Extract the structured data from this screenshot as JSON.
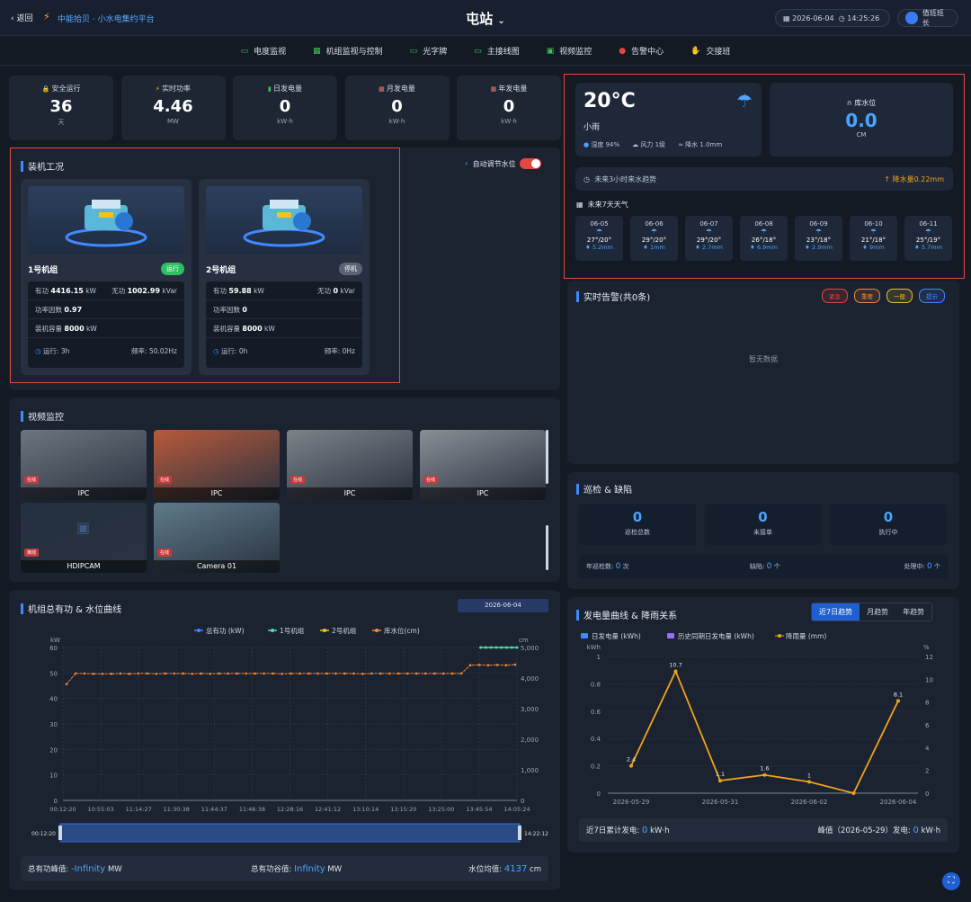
{
  "header": {
    "back": "返回",
    "brand": "中能拾贝 · 小水电集约平台",
    "title": "屯站",
    "date": "2026-06-04",
    "time": "14:25:26",
    "user": "值班班长"
  },
  "nav": [
    {
      "label": "电度监视",
      "icon": "monitor-icon"
    },
    {
      "label": "机组监视与控制",
      "icon": "control-icon"
    },
    {
      "label": "光字牌",
      "icon": "monitor-icon"
    },
    {
      "label": "主接线图",
      "icon": "monitor-icon"
    },
    {
      "label": "视频监控",
      "icon": "video-icon"
    },
    {
      "label": "告警中心",
      "icon": "alert-icon"
    },
    {
      "label": "交接班",
      "icon": "hand-icon"
    }
  ],
  "stats": [
    {
      "label": "安全运行",
      "value": "36",
      "unit": "天",
      "icon": "lock-icon"
    },
    {
      "label": "实时功率",
      "value": "4.46",
      "unit": "MW",
      "icon": "bolt-icon"
    },
    {
      "label": "日发电量",
      "value": "0",
      "unit": "kW·h",
      "icon": "bar-icon"
    },
    {
      "label": "月发电量",
      "value": "0",
      "unit": "kW·h",
      "icon": "calendar-icon"
    },
    {
      "label": "年发电量",
      "value": "0",
      "unit": "kW·h",
      "icon": "calendar-icon"
    }
  ],
  "units_panel": {
    "title": "装机工况",
    "auto_label": "自动调节水位",
    "units": [
      {
        "name": "1号机组",
        "status": "运行",
        "status_color": "#2fbf62",
        "p": "4416.15",
        "p_unit": "kW",
        "q": "1002.99",
        "q_unit": "kVar",
        "pf": "0.97",
        "cap": "8000",
        "cap_unit": "kW",
        "run": "运行: 3h",
        "freq": "频率: 50.02Hz"
      },
      {
        "name": "2号机组",
        "status": "停机",
        "status_color": "#5a6474",
        "p": "59.88",
        "p_unit": "kW",
        "q": "0",
        "q_unit": "kVar",
        "pf": "0",
        "cap": "8000",
        "cap_unit": "kW",
        "run": "运行: 0h",
        "freq": "频率: 0Hz"
      }
    ],
    "labels": {
      "p": "有功",
      "q": "无功",
      "pf": "功率因数",
      "cap": "装机容量"
    }
  },
  "weather": {
    "temp": "20°C",
    "desc": "小雨",
    "humidity": "湿度 94%",
    "wind": "风力 1级",
    "rain": "降水 1.0mm",
    "level_label": "库水位",
    "level_value": "0.0",
    "level_unit": "CM",
    "trend_label": "未来3小时来水趋势",
    "trend_value": "降水量0.22mm",
    "week_label": "未来7天天气",
    "days": [
      {
        "d": "06-05",
        "t": "27°/20°",
        "r": "5.2mm"
      },
      {
        "d": "06-06",
        "t": "29°/20°",
        "r": "1mm"
      },
      {
        "d": "06-07",
        "t": "29°/20°",
        "r": "2.7mm"
      },
      {
        "d": "06-08",
        "t": "26°/18°",
        "r": "6.9mm"
      },
      {
        "d": "06-09",
        "t": "23°/18°",
        "r": "2.9mm"
      },
      {
        "d": "06-10",
        "t": "21°/18°",
        "r": "9mm"
      },
      {
        "d": "06-11",
        "t": "25°/19°",
        "r": "5.7mm"
      }
    ]
  },
  "alarms": {
    "title": "实时告警(共0条)",
    "empty": "暂无数据",
    "tags": [
      {
        "label": "紧急",
        "color": "#e5473f"
      },
      {
        "label": "重要",
        "color": "#f08a3c"
      },
      {
        "label": "一般",
        "color": "#e8c23a"
      },
      {
        "label": "提示",
        "color": "#3d8bff"
      }
    ]
  },
  "video": {
    "title": "视频监控",
    "cams": [
      {
        "name": "IPC",
        "tag": "在线"
      },
      {
        "name": "IPC",
        "tag": "在线"
      },
      {
        "name": "IPC",
        "tag": "在线"
      },
      {
        "name": "IPC",
        "tag": "在线"
      },
      {
        "name": "HDIPCAM",
        "tag": "离线"
      },
      {
        "name": "Camera 01",
        "tag": "在线"
      }
    ]
  },
  "inspect": {
    "title": "巡检 & 缺陷",
    "cards": [
      {
        "v": "0",
        "l": "巡检总数"
      },
      {
        "v": "0",
        "l": "未接单"
      },
      {
        "v": "0",
        "l": "执行中"
      }
    ],
    "footer": [
      {
        "l": "年巡检数:",
        "v": "0",
        "u": "次"
      },
      {
        "l": "缺陷:",
        "v": "0",
        "u": "个"
      },
      {
        "l": "处理中:",
        "v": "0",
        "u": "个"
      }
    ]
  },
  "power_chart": {
    "title": "机组总有功 & 水位曲线",
    "date": "2026-06-04",
    "slider_start": "00:12:20",
    "slider_end": "14:22:12",
    "peak_label": "总有功峰值:",
    "peak_value": "-Infinity",
    "valley_label": "总有功谷值:",
    "valley_value": "Infinity",
    "mw": "MW",
    "level_avg_label": "水位均值:",
    "level_avg_value": "4137",
    "cm": "cm"
  },
  "gen_chart": {
    "title": "发电量曲线 & 降雨关系",
    "tabs": [
      "近7日趋势",
      "月趋势",
      "年趋势"
    ],
    "total_label": "近7日累计发电:",
    "total_value": "0",
    "total_unit": "kW·h",
    "peak_label": "峰值（2026-05-29）发电:",
    "peak_value": "0",
    "peak_unit": "kW·h"
  },
  "chart_data": [
    {
      "type": "line",
      "title": "机组总有功 & 水位曲线",
      "legend": [
        "总有功 (kW)",
        "1号机组",
        "2号机组",
        "库水位(cm)"
      ],
      "x": [
        "00:12:20",
        "10:55:03",
        "11:14:27",
        "11:30:38",
        "11:44:37",
        "11:46:38",
        "12:28:16",
        "12:41:12",
        "13:10:14",
        "13:15:20",
        "13:25:00",
        "13:45:54",
        "14:05:24"
      ],
      "ylim_left": [
        0,
        60
      ],
      "yticks_left": [
        0,
        10,
        20,
        30,
        40,
        50,
        60
      ],
      "ylabel_left": "kW",
      "ylim_right": [
        0,
        5000
      ],
      "yticks_right": [
        "0",
        "1,000",
        "2,000",
        "3,000",
        "4,000",
        "5,000"
      ],
      "ylabel_right": "cm",
      "series": [
        {
          "name": "库水位(cm)",
          "axis": "right",
          "color": "#f08a3c",
          "values": [
            3800,
            4150,
            4150,
            4140,
            4140,
            4140,
            4150,
            4140,
            4150,
            4150,
            4140,
            4150,
            4150,
            4150,
            4140,
            4150,
            4140,
            4150,
            4150,
            4150,
            4150,
            4150,
            4150,
            4150,
            4140,
            4150,
            4150,
            4150,
            4150,
            4150,
            4150,
            4150,
            4150,
            4140,
            4150,
            4150,
            4150,
            4150,
            4150,
            4150,
            4150,
            4150,
            4150,
            4150,
            4150,
            4420,
            4430,
            4420,
            4430,
            4420,
            4440
          ]
        },
        {
          "name": "1号机组",
          "axis": "left",
          "color": "#4ee0a0",
          "values_tail": [
            60,
            60,
            60,
            60,
            60,
            60,
            60,
            60
          ]
        }
      ]
    },
    {
      "type": "line",
      "title": "发电量曲线 & 降雨关系",
      "legend": [
        "日发电量 (kWh)",
        "历史同期日发电量 (kWh)",
        "降雨量 (mm)"
      ],
      "x": [
        "2026-05-29",
        "2026-05-30",
        "2026-05-31",
        "2026-06-01",
        "2026-06-02",
        "2026-06-03",
        "2026-06-04"
      ],
      "xticks": [
        "2026-05-29",
        "2026-05-31",
        "2026-06-02",
        "2026-06-04"
      ],
      "ylim_left": [
        0,
        1
      ],
      "yticks_left": [
        0,
        0.2,
        0.4,
        0.6,
        0.8,
        1
      ],
      "ylabel_left": "kWh",
      "ylim_right": [
        0,
        12
      ],
      "yticks_right": [
        0,
        2,
        4,
        6,
        8,
        10,
        12
      ],
      "ylabel_right": "%",
      "series": [
        {
          "name": "降雨量 (mm)",
          "axis": "right",
          "color": "#f0a41e",
          "values": [
            2.4,
            10.7,
            1.1,
            1.6,
            1,
            0,
            8.1
          ],
          "labels": [
            "2.4",
            "10.7",
            "1.1",
            "1.6",
            "1",
            "",
            "8.1"
          ]
        }
      ]
    }
  ]
}
